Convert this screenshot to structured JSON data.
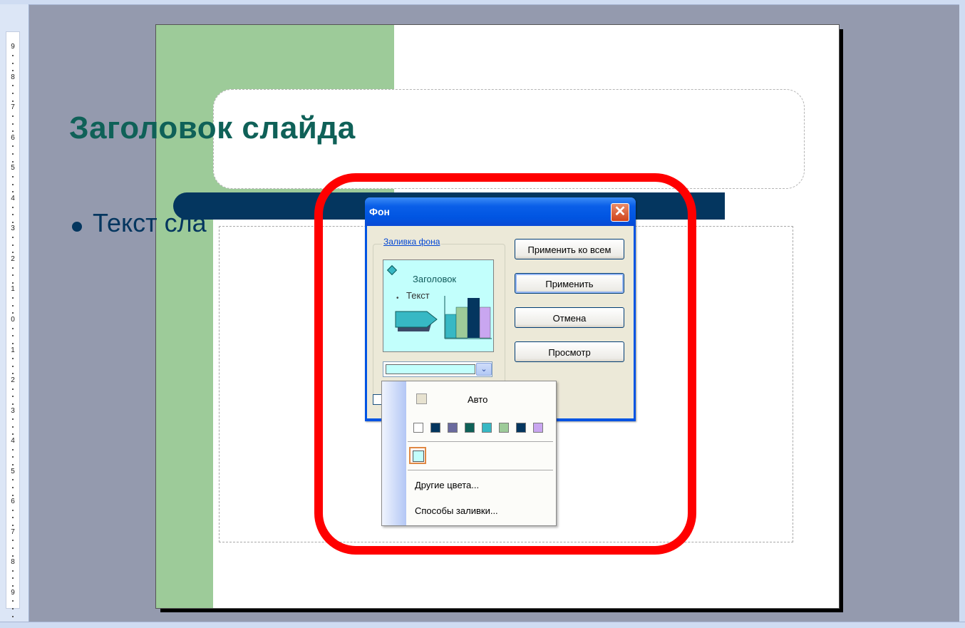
{
  "ruler": {
    "labels": [
      "9",
      "8",
      "7",
      "6",
      "5",
      "4",
      "3",
      "2",
      "1",
      "0",
      "1",
      "2",
      "3",
      "4",
      "5",
      "6",
      "7",
      "8",
      "9"
    ]
  },
  "slide": {
    "title": "Заголовок слайда",
    "bullet_text": "Текст сла"
  },
  "dialog": {
    "title": "Фон",
    "close_glyph": "✕",
    "group_label": "Заливка фона",
    "preview": {
      "heading": "Заголовок",
      "bullet": "•",
      "text": "Текст"
    },
    "combo_arrow": "⌄",
    "buttons": {
      "apply_all": "Применить ко всем",
      "apply": "Применить",
      "cancel": "Отмена",
      "preview": "Просмотр"
    }
  },
  "dropdown": {
    "auto_label": "Авто",
    "palette": [
      "#ffffff",
      "#04365f",
      "#6a6a9e",
      "#0f6158",
      "#37b8c4",
      "#9dcb99",
      "#04365f",
      "#c9a6f0"
    ],
    "recent_color": "#c2fffc",
    "more_colors": "Другие цвета...",
    "fill_effects": "Способы заливки..."
  },
  "colors": {
    "highlight": "#ff0000",
    "slide_green": "#9dcb99",
    "navy": "#04365f",
    "title_teal": "#0f6158",
    "preview_bg": "#c2fffc"
  }
}
